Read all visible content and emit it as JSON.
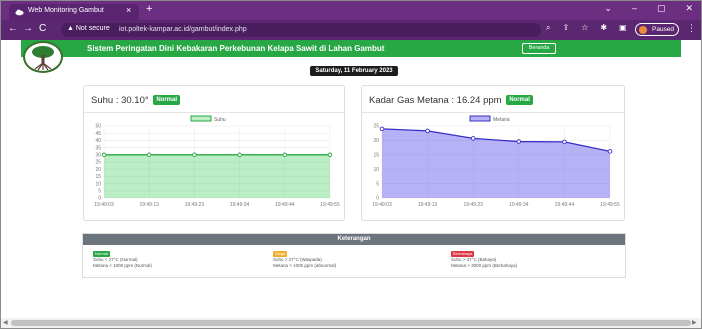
{
  "browser": {
    "tab_title": "Web Monitoring Gambut",
    "tab_close": "×",
    "new_tab": "+",
    "window_controls": [
      "⌄",
      "–",
      "▢",
      "✕"
    ],
    "nav": {
      "back": "←",
      "forward": "→",
      "reload": "C"
    },
    "omnibox": {
      "security": "▲ Not secure",
      "url": "iot.poltek-kampar.ac.id/gambut/index.php"
    },
    "toolbar_icons": [
      "⌕",
      "⇪",
      "☆",
      "✱",
      "▣"
    ],
    "profile_status": "Paused",
    "menu": "⋮"
  },
  "header": {
    "title": "Sistem Peringatan Dini Kebakaran Perkebunan Kelapa Sawit di Lahan Gambut",
    "home_button": "Beranda"
  },
  "date": "Saturday, 11 February 2023",
  "temperature": {
    "title": "Suhu : 30.10°",
    "status": "Normal"
  },
  "methane": {
    "title": "Kadar Gas Metana : 16.24 ppm",
    "status": "Normal"
  },
  "chart_data": [
    {
      "type": "area",
      "series": [
        {
          "name": "Suhu",
          "values": [
            30,
            30,
            30,
            30,
            30,
            30
          ]
        }
      ],
      "categories": [
        "19:49:03",
        "19:49:13",
        "19:49:23",
        "19:49:34",
        "19:49:44",
        "19:49:55"
      ],
      "yticks": [
        0,
        5,
        10,
        15,
        20,
        25,
        30,
        35,
        40,
        45,
        50
      ],
      "ylim": [
        0,
        50
      ],
      "color": "#28a745",
      "fill": "rgba(60,205,90,0.35)",
      "legend": "top"
    },
    {
      "type": "area",
      "series": [
        {
          "name": "Metana",
          "values": [
            24,
            23.3,
            20.7,
            19.6,
            19.5,
            16.2
          ]
        }
      ],
      "categories": [
        "19:49:03",
        "19:49:13",
        "19:49:23",
        "19:49:34",
        "19:49:44",
        "19:49:55"
      ],
      "yticks": [
        0,
        5,
        10,
        15,
        20,
        25
      ],
      "ylim": [
        0,
        25
      ],
      "color": "#3730c8",
      "fill": "rgba(95,85,235,0.45)",
      "legend": "top"
    }
  ],
  "keterangan": {
    "title": "Keterangan",
    "items": [
      {
        "badge": "Normal",
        "color": "#28a745",
        "line1": "Suhu < 27°C (Normal)",
        "line2": "Metana < 1000 ppm (Normal)"
      },
      {
        "badge": "Siaga",
        "color": "#f0ad28",
        "line1": "Suhu > 27°C (Waspada)",
        "line2": "Metana > 1000 ppm (abnormal)"
      },
      {
        "badge": "Berbahaya",
        "color": "#dc3545",
        "line1": "Suhu > 37°C (Bahaya)",
        "line2": "Metana > 3000 ppm (Berbahaya)"
      }
    ]
  },
  "scrollbar": {
    "left": "◀",
    "right": "▶"
  }
}
